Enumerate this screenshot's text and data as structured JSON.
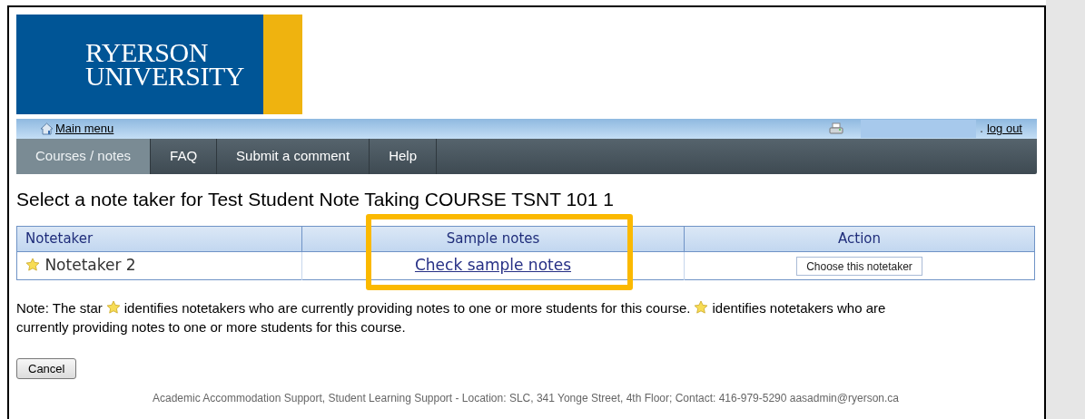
{
  "logo": {
    "lines": [
      "RYERSON",
      "UNIVERSITY"
    ]
  },
  "topbar": {
    "main_menu": "Main menu",
    "separator": ".",
    "logout": "log out"
  },
  "tabs": [
    {
      "label": "Courses / notes",
      "selected": true
    },
    {
      "label": "FAQ",
      "selected": false
    },
    {
      "label": "Submit a comment",
      "selected": false
    },
    {
      "label": "Help",
      "selected": false
    }
  ],
  "heading": "Select a note taker for Test Student Note Taking COURSE TSNT 101 1",
  "table": {
    "columns": [
      "Notetaker",
      "Sample notes",
      "Action"
    ],
    "rows": [
      {
        "name": "Notetaker 2",
        "starred": true,
        "link": "Check sample notes",
        "action": "Choose this notetaker"
      }
    ]
  },
  "note": {
    "lines": [
      [
        "Note: The star",
        "identifies notetakers who are currently providing notes to one or more students for this course.",
        "identifies notetakers who are"
      ],
      [
        "currently providing notes to one or more students for this course."
      ]
    ]
  },
  "cancel": "Cancel",
  "footer": "Academic Accommodation Support, Student Learning Support - Location: SLC, 341 Yonge Street, 4th Floor; Contact: 416-979-5290 aasadmin@ryerson.ca"
}
